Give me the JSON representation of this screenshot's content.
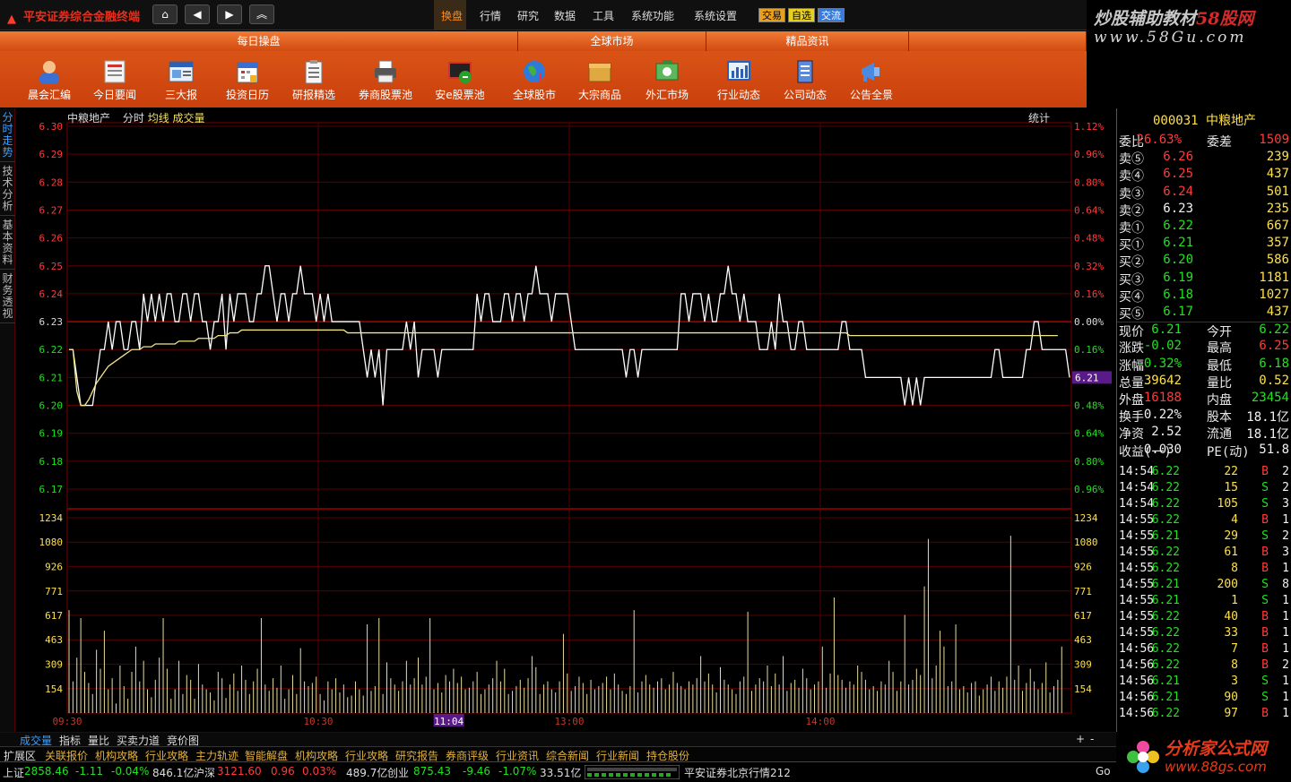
{
  "app": {
    "title": "平安证券综合金融终端"
  },
  "nav": {
    "home": "⌂",
    "back": "◀",
    "forward": "▶",
    "up": "︽"
  },
  "menu": [
    "换盘",
    "行情",
    "研究",
    "数据",
    "工具",
    "系统功能",
    "系统设置"
  ],
  "trade_buttons": [
    "交易",
    "自选",
    "交流"
  ],
  "brand": {
    "line1_a": "炒股辅助教材",
    "line1_b": "58股网",
    "line2": "www.58Gu.com"
  },
  "ribbon": {
    "groups": [
      "每日操盘",
      "全球市场",
      "精品资讯"
    ],
    "items": [
      "晨会汇编",
      "今日要闻",
      "三大报",
      "投资日历",
      "研报精选",
      "券商股票池",
      "安e股票池",
      "全球股市",
      "大宗商品",
      "外汇市场",
      "行业动态",
      "公司动态",
      "公告全景"
    ]
  },
  "left_tabs": [
    "分时走势",
    "技术分析",
    "基本资料",
    "财务透视"
  ],
  "chart_header": {
    "name": "中粮地产",
    "mode": "分时",
    "ma": "均线",
    "vol": "成交量",
    "stat": "统计"
  },
  "chart_data": {
    "type": "line",
    "title": "",
    "price_axis": {
      "ylim": [
        6.17,
        6.3
      ],
      "ticks": [
        "6.30",
        "6.29",
        "6.28",
        "6.27",
        "6.26",
        "6.25",
        "6.24",
        "6.23",
        "6.22",
        "6.21",
        "6.20",
        "6.19",
        "6.18",
        "6.17"
      ],
      "prev_close": 6.23
    },
    "pct_ticks": [
      "1.12%",
      "0.96%",
      "0.80%",
      "0.64%",
      "0.48%",
      "0.32%",
      "0.16%",
      "0.00%",
      "0.16%",
      "0.32%",
      "0.48%",
      "0.64%",
      "0.80%",
      "0.96%"
    ],
    "volume_axis": {
      "ylim": [
        0,
        1234
      ],
      "ticks": [
        "1234",
        "1080",
        "926",
        "771",
        "617",
        "463",
        "309",
        "154"
      ]
    },
    "time_labels": [
      "09:30",
      "10:30",
      "11:04",
      "13:00",
      "14:00"
    ],
    "current_price_label": "6.21",
    "series": [
      {
        "kind": "price",
        "values": [
          6.22,
          6.22,
          6.21,
          6.2,
          6.2,
          6.2,
          6.2,
          6.21,
          6.22,
          6.22,
          6.23,
          6.22,
          6.23,
          6.23,
          6.22,
          6.22,
          6.23,
          6.23,
          6.22,
          6.24,
          6.23,
          6.24,
          6.23,
          6.24,
          6.23,
          6.24,
          6.24,
          6.23,
          6.23,
          6.24,
          6.24,
          6.23,
          6.24,
          6.24,
          6.23,
          6.23,
          6.22,
          6.23,
          6.23,
          6.24,
          6.22,
          6.24,
          6.23,
          6.24,
          6.24,
          6.24,
          6.23,
          6.23,
          6.24,
          6.24,
          6.25,
          6.25,
          6.24,
          6.23,
          6.24,
          6.24,
          6.23,
          6.24,
          6.24,
          6.25,
          6.24,
          6.24,
          6.24,
          6.23,
          6.24,
          6.23,
          6.24,
          6.23,
          6.23,
          6.23,
          6.23,
          6.23,
          6.23,
          6.23,
          6.23,
          6.22,
          6.21,
          6.22,
          6.21,
          6.22,
          6.2,
          6.22,
          6.22,
          6.22,
          6.22,
          6.22,
          6.23,
          6.22,
          6.23,
          6.21,
          6.22,
          6.22,
          6.22,
          6.22,
          6.21,
          6.22,
          6.22,
          6.22,
          6.22,
          6.22,
          6.22,
          6.22,
          6.22,
          6.22,
          6.24,
          6.23,
          6.24,
          6.24,
          6.23,
          6.23,
          6.23,
          6.24,
          6.24,
          6.23,
          6.24,
          6.24,
          6.23,
          6.24,
          6.24,
          6.25,
          6.24,
          6.24,
          6.24,
          6.23,
          6.24,
          6.24,
          6.24,
          6.24,
          6.23,
          6.22,
          6.22,
          6.22,
          6.22,
          6.22,
          6.22,
          6.22,
          6.22,
          6.22,
          6.22,
          6.22,
          6.22,
          6.22,
          6.21,
          6.22,
          6.22,
          6.21,
          6.22,
          6.22,
          6.22,
          6.22,
          6.22,
          6.22,
          6.22,
          6.22,
          6.22,
          6.22,
          6.24,
          6.24,
          6.23,
          6.24,
          6.24,
          6.24,
          6.23,
          6.24,
          6.23,
          6.23,
          6.24,
          6.24,
          6.25,
          6.24,
          6.24,
          6.23,
          6.24,
          6.23,
          6.23,
          6.23,
          6.22,
          6.22,
          6.22,
          6.23,
          6.22,
          6.24,
          6.23,
          6.23,
          6.22,
          6.22,
          6.23,
          6.23,
          6.22,
          6.22,
          6.22,
          6.22,
          6.22,
          6.22,
          6.22,
          6.22,
          6.22,
          6.23,
          6.23,
          6.22,
          6.22,
          6.22,
          6.22,
          6.21,
          6.21,
          6.21,
          6.21,
          6.21,
          6.21,
          6.21,
          6.21,
          6.21,
          6.21,
          6.2,
          6.21,
          6.2,
          6.21,
          6.2,
          6.21,
          6.21,
          6.21,
          6.21,
          6.21,
          6.21,
          6.21,
          6.21,
          6.21,
          6.21,
          6.21,
          6.21,
          6.21,
          6.21,
          6.21,
          6.21,
          6.21,
          6.21,
          6.22,
          6.22,
          6.21,
          6.21,
          6.21,
          6.21,
          6.21,
          6.21,
          6.22,
          6.22,
          6.23,
          6.23,
          6.22,
          6.22,
          6.22,
          6.22,
          6.22,
          6.22,
          6.22,
          6.21
        ]
      },
      {
        "kind": "average",
        "values": [
          6.22,
          6.22,
          6.205,
          6.2,
          6.2,
          6.202,
          6.205,
          6.208,
          6.21,
          6.212,
          6.214,
          6.215,
          6.216,
          6.217,
          6.218,
          6.219,
          6.22,
          6.22,
          6.22,
          6.221,
          6.221,
          6.221,
          6.222,
          6.222,
          6.222,
          6.222,
          6.222,
          6.222,
          6.223,
          6.223,
          6.223,
          6.223,
          6.223,
          6.224,
          6.224,
          6.224,
          6.224,
          6.224,
          6.225,
          6.225,
          6.225,
          6.226,
          6.226,
          6.226,
          6.227,
          6.227,
          6.227,
          6.227,
          6.227,
          6.227,
          6.227,
          6.227,
          6.227,
          6.227,
          6.227,
          6.227,
          6.227,
          6.227,
          6.227,
          6.227,
          6.227,
          6.227,
          6.227,
          6.227,
          6.227,
          6.227,
          6.227,
          6.227,
          6.227,
          6.227,
          6.227,
          6.226,
          6.226,
          6.226,
          6.226,
          6.226,
          6.226,
          6.226,
          6.226,
          6.226,
          6.226,
          6.226,
          6.226,
          6.226,
          6.226,
          6.226,
          6.226,
          6.226,
          6.226,
          6.226,
          6.226,
          6.226,
          6.226,
          6.226,
          6.226,
          6.226,
          6.226,
          6.226,
          6.226,
          6.226,
          6.226,
          6.226,
          6.226,
          6.226,
          6.226,
          6.226,
          6.226,
          6.226,
          6.226,
          6.226,
          6.226,
          6.226,
          6.226,
          6.226,
          6.226,
          6.226,
          6.226,
          6.226,
          6.226,
          6.226,
          6.226,
          6.226,
          6.226,
          6.226,
          6.226,
          6.226,
          6.226,
          6.226,
          6.226,
          6.226,
          6.226,
          6.226,
          6.226,
          6.226,
          6.226,
          6.226,
          6.226,
          6.226,
          6.226,
          6.226,
          6.226,
          6.226,
          6.226,
          6.226,
          6.226,
          6.226,
          6.226,
          6.226,
          6.226,
          6.226,
          6.226,
          6.226,
          6.226,
          6.226,
          6.226,
          6.226,
          6.226,
          6.226,
          6.226,
          6.226,
          6.226,
          6.226,
          6.226,
          6.226,
          6.226,
          6.226,
          6.226,
          6.226,
          6.226,
          6.226,
          6.226,
          6.226,
          6.226,
          6.226,
          6.226,
          6.226,
          6.226,
          6.226,
          6.226,
          6.226,
          6.226,
          6.226,
          6.226,
          6.226,
          6.226,
          6.226,
          6.226,
          6.226,
          6.226,
          6.226,
          6.226,
          6.226,
          6.226,
          6.226,
          6.226,
          6.226,
          6.226,
          6.226,
          6.226,
          6.225,
          6.225,
          6.225,
          6.225,
          6.225,
          6.225,
          6.225,
          6.225,
          6.225,
          6.225,
          6.225,
          6.225,
          6.225,
          6.225,
          6.225,
          6.225,
          6.225,
          6.225,
          6.225,
          6.225,
          6.225,
          6.225,
          6.225,
          6.225,
          6.225,
          6.225,
          6.225,
          6.225,
          6.225,
          6.225,
          6.225,
          6.225,
          6.225,
          6.225,
          6.225,
          6.225,
          6.225,
          6.225,
          6.225,
          6.225,
          6.225,
          6.225,
          6.225,
          6.225,
          6.225,
          6.225,
          6.225,
          6.225,
          6.225,
          6.225,
          6.225,
          6.225,
          6.225,
          6.225
        ]
      },
      {
        "kind": "volume",
        "values": [
          650,
          200,
          350,
          600,
          260,
          190,
          120,
          400,
          280,
          520,
          150,
          220,
          60,
          300,
          170,
          90,
          260,
          420,
          200,
          330,
          150,
          100,
          210,
          350,
          600,
          280,
          90,
          150,
          330,
          120,
          240,
          210,
          90,
          310,
          180,
          150,
          130,
          80,
          260,
          220,
          95,
          180,
          250,
          140,
          300,
          210,
          120,
          200,
          280,
          600,
          180,
          140,
          220,
          160,
          300,
          90,
          150,
          240,
          120,
          410,
          200,
          170,
          190,
          230,
          120,
          80,
          200,
          150,
          220,
          130,
          180,
          100,
          110,
          200,
          150,
          110,
          560,
          140,
          170,
          600,
          120,
          320,
          220,
          180,
          140,
          200,
          330,
          180,
          220,
          350,
          180,
          230,
          600,
          150,
          190,
          130,
          240,
          200,
          280,
          190,
          230,
          150,
          160,
          200,
          260,
          120,
          150,
          180,
          220,
          330,
          200,
          280,
          120,
          140,
          170,
          210,
          160,
          220,
          360,
          290,
          120,
          180,
          200,
          150,
          130,
          200,
          500,
          250,
          140,
          170,
          230,
          190,
          120,
          210,
          150,
          170,
          190,
          230,
          150,
          250,
          180,
          140,
          120,
          170,
          650,
          130,
          200,
          240,
          180,
          160,
          200,
          220,
          150,
          180,
          260,
          190,
          170,
          150,
          200,
          180,
          220,
          360,
          200,
          250,
          180,
          130,
          290,
          210,
          180,
          150,
          120,
          200,
          230,
          640,
          140,
          180,
          220,
          200,
          300,
          170,
          250,
          180,
          360,
          140,
          190,
          210,
          160,
          280,
          220,
          150,
          180,
          200,
          420,
          160,
          250,
          730,
          240,
          210,
          160,
          200,
          180,
          300,
          260,
          210,
          150,
          170,
          140,
          200,
          180,
          330,
          260,
          140,
          200,
          620,
          180,
          210,
          280,
          240,
          800,
          1100,
          220,
          300,
          520,
          420,
          170,
          200,
          560,
          150,
          170,
          130,
          190,
          200,
          110,
          150,
          180,
          230,
          140,
          200,
          160,
          230,
          1120,
          210,
          300,
          140,
          190,
          280,
          200,
          150,
          190,
          320,
          130,
          170,
          210,
          420
        ]
      }
    ]
  },
  "quote": {
    "title": "000031 中粮地产",
    "rows": [
      {
        "l": "委比",
        "v": "26.63%",
        "l2": "委差",
        "v2": "1509",
        "c": "red",
        "c2": "red"
      },
      {
        "l": "卖⑤",
        "v": "6.26",
        "v2": "239",
        "c": "red",
        "c2": "yel"
      },
      {
        "l": "卖④",
        "v": "6.25",
        "v2": "437",
        "c": "red",
        "c2": "yel"
      },
      {
        "l": "卖③",
        "v": "6.24",
        "v2": "501",
        "c": "red",
        "c2": "yel"
      },
      {
        "l": "卖②",
        "v": "6.23",
        "v2": "235",
        "c": "wht",
        "c2": "yel"
      },
      {
        "l": "卖①",
        "v": "6.22",
        "v2": "667",
        "c": "grn",
        "c2": "yel"
      },
      {
        "l": "买①",
        "v": "6.21",
        "v2": "357",
        "c": "grn",
        "c2": "yel"
      },
      {
        "l": "买②",
        "v": "6.20",
        "v2": "586",
        "c": "grn",
        "c2": "yel"
      },
      {
        "l": "买③",
        "v": "6.19",
        "v2": "1181",
        "c": "grn",
        "c2": "yel"
      },
      {
        "l": "买④",
        "v": "6.18",
        "v2": "1027",
        "c": "grn",
        "c2": "yel"
      },
      {
        "l": "买⑤",
        "v": "6.17",
        "v2": "437",
        "c": "grn",
        "c2": "yel"
      },
      {
        "l": "现价",
        "v": "6.21",
        "l2": "今开",
        "v2": "6.22",
        "c": "grn",
        "c2": "grn"
      },
      {
        "l": "涨跌",
        "v": "-0.02",
        "l2": "最高",
        "v2": "6.25",
        "c": "grn",
        "c2": "red"
      },
      {
        "l": "涨幅",
        "v": "-0.32%",
        "l2": "最低",
        "v2": "6.18",
        "c": "grn",
        "c2": "grn"
      },
      {
        "l": "总量",
        "v": "39642",
        "l2": "量比",
        "v2": "0.52",
        "c": "yel",
        "c2": "yel"
      },
      {
        "l": "外盘",
        "v": "16188",
        "l2": "内盘",
        "v2": "23454",
        "c": "red",
        "c2": "grn"
      },
      {
        "l": "换手",
        "v": "0.22%",
        "l2": "股本",
        "v2": "18.1亿",
        "c": "wht",
        "c2": "wht"
      },
      {
        "l": "净资",
        "v": "2.52",
        "l2": "流通",
        "v2": "18.1亿",
        "c": "wht",
        "c2": "wht"
      },
      {
        "l": "收益(一)",
        "v": "0.030",
        "l2": "PE(动)",
        "v2": "51.8",
        "c": "wht",
        "c2": "wht"
      }
    ],
    "ticks": [
      {
        "t": "14:54",
        "p": "6.22",
        "q": "22",
        "d": "B",
        "n": "2"
      },
      {
        "t": "14:54",
        "p": "6.22",
        "q": "15",
        "d": "S",
        "n": "2"
      },
      {
        "t": "14:54",
        "p": "6.22",
        "q": "105",
        "d": "S",
        "n": "3"
      },
      {
        "t": "14:55",
        "p": "6.22",
        "q": "4",
        "d": "B",
        "n": "1"
      },
      {
        "t": "14:55",
        "p": "6.21",
        "q": "29",
        "d": "S",
        "n": "2"
      },
      {
        "t": "14:55",
        "p": "6.22",
        "q": "61",
        "d": "B",
        "n": "3"
      },
      {
        "t": "14:55",
        "p": "6.22",
        "q": "8",
        "d": "B",
        "n": "1"
      },
      {
        "t": "14:55",
        "p": "6.21",
        "q": "200",
        "d": "S",
        "n": "8"
      },
      {
        "t": "14:55",
        "p": "6.21",
        "q": "1",
        "d": "S",
        "n": "1"
      },
      {
        "t": "14:55",
        "p": "6.22",
        "q": "40",
        "d": "B",
        "n": "1"
      },
      {
        "t": "14:55",
        "p": "6.22",
        "q": "33",
        "d": "B",
        "n": "1"
      },
      {
        "t": "14:56",
        "p": "6.22",
        "q": "7",
        "d": "B",
        "n": "1"
      },
      {
        "t": "14:56",
        "p": "6.22",
        "q": "8",
        "d": "B",
        "n": "2"
      },
      {
        "t": "14:56",
        "p": "6.21",
        "q": "3",
        "d": "S",
        "n": "1"
      },
      {
        "t": "14:56",
        "p": "6.21",
        "q": "90",
        "d": "S",
        "n": "1"
      },
      {
        "t": "14:56",
        "p": "6.22",
        "q": "97",
        "d": "B",
        "n": "1"
      }
    ]
  },
  "bottom_tabs": [
    "成交量",
    "指标",
    "量比",
    "买卖力道",
    "竞价图"
  ],
  "bottom_ctrl": [
    "+",
    "-"
  ],
  "bar2": [
    "扩展区",
    "关联报价",
    "机构攻略",
    "行业攻略",
    "主力轨迹",
    "智能解盘",
    "机构攻略",
    "行业攻略",
    "研究报告",
    "券商评级",
    "行业资讯",
    "综合新闻",
    "行业新闻",
    "持仓股份"
  ],
  "status": {
    "sh_label": "上证",
    "sh_val": "2858.46",
    "sh_chg": "-1.11",
    "sh_pct": "-0.04%",
    "sh_amt": "846.1亿",
    "sz_label": "沪深",
    "sz_val": "3121.60",
    "sz_chg": "0.96",
    "sz_pct": "0.03%",
    "sz_amt": "489.7亿",
    "cy_label": "创业",
    "cy_val": "875.43",
    "cy_chg": "-9.46",
    "cy_pct": "-1.07%",
    "cy_amt": "33.51亿",
    "server": "平安证券北京行情212",
    "go": "Go"
  },
  "footer_brand": {
    "name": "分析家公式网",
    "url": "www.88gs.com"
  },
  "colors": {
    "accent": "#e0521a",
    "up": "#ff3b3b",
    "down": "#22e022",
    "grid": "#7a0000"
  }
}
